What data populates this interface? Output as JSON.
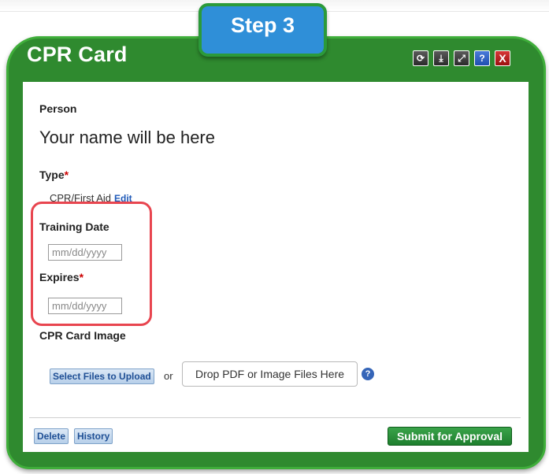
{
  "step_badge": "Step 3",
  "dialog": {
    "title": "CPR Card",
    "toolbar": [
      {
        "icon": "refresh-icon",
        "glyph": "⟳"
      },
      {
        "icon": "download-icon",
        "glyph": "⤓"
      },
      {
        "icon": "expand-icon",
        "glyph": "⤢"
      },
      {
        "icon": "help-icon",
        "glyph": "?"
      },
      {
        "icon": "close-icon",
        "glyph": "X"
      }
    ]
  },
  "form": {
    "person_label": "Person",
    "person_name": "Your name will be here",
    "type_label": "Type",
    "required_mark": "*",
    "type_value": "CPR/First Aid",
    "type_edit": "Edit",
    "training_date_label": "Training Date",
    "training_date_placeholder": "mm/dd/yyyy",
    "expires_label": "Expires",
    "expires_placeholder": "mm/dd/yyyy",
    "card_image_label": "CPR Card Image",
    "select_files": "Select Files to Upload",
    "or_text": "or",
    "drop_zone": "Drop PDF or Image Files Here",
    "help_glyph": "?"
  },
  "footer": {
    "delete": "Delete",
    "history": "History",
    "submit": "Submit for Approval"
  },
  "colors": {
    "panel_green": "#2f8a2f",
    "step_blue": "#2f8fd8",
    "highlight_red": "#e8454f",
    "link_blue": "#1f5ab8"
  }
}
